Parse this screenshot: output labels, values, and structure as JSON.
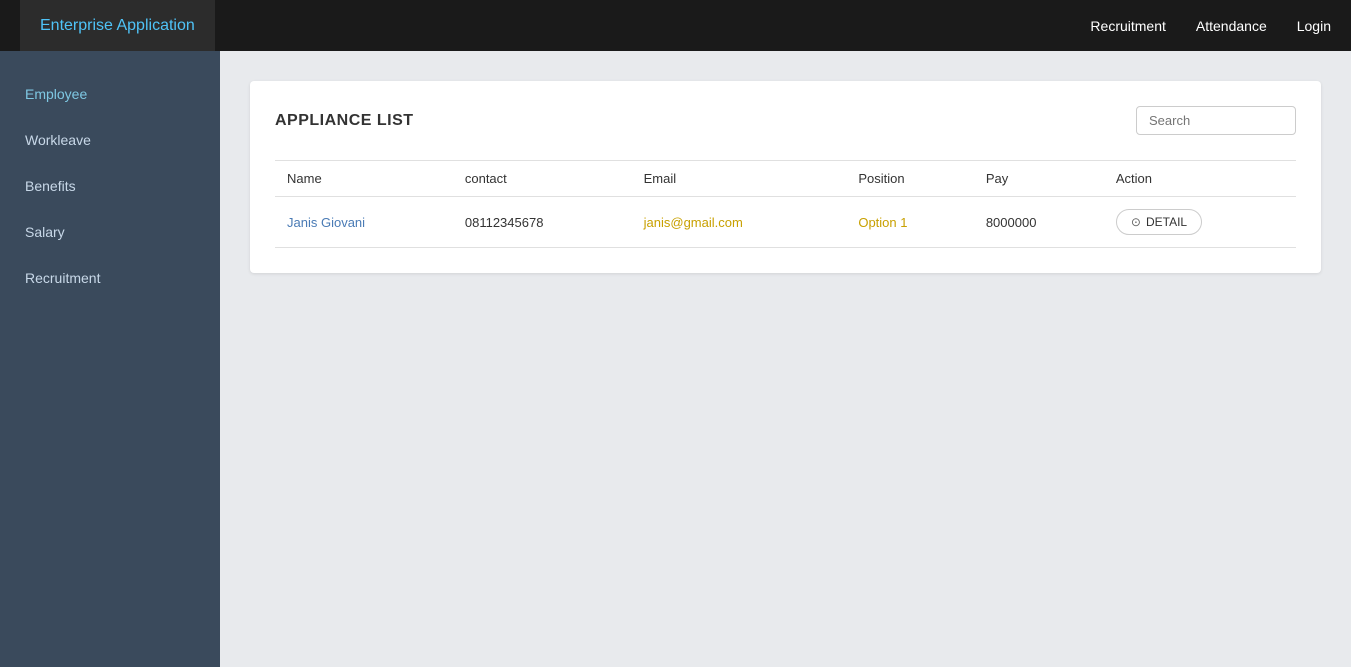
{
  "navbar": {
    "brand": "Enterprise Application",
    "links": [
      {
        "label": "Recruitment",
        "href": "#"
      },
      {
        "label": "Attendance",
        "href": "#"
      },
      {
        "label": "Login",
        "href": "#"
      }
    ]
  },
  "sidebar": {
    "items": [
      {
        "label": "Employee",
        "active": true
      },
      {
        "label": "Workleave",
        "active": false
      },
      {
        "label": "Benefits",
        "active": false
      },
      {
        "label": "Salary",
        "active": false
      },
      {
        "label": "Recruitment",
        "active": false
      }
    ]
  },
  "main": {
    "card": {
      "title": "APPLIANCE LIST",
      "search_placeholder": "Search",
      "table": {
        "columns": [
          "Name",
          "contact",
          "Email",
          "Position",
          "Pay",
          "Action"
        ],
        "rows": [
          {
            "name": "Janis Giovani",
            "contact": "08112345678",
            "email": "janis@gmail.com",
            "position": "Option 1",
            "pay": "8000000",
            "action_label": "DETAIL"
          }
        ]
      }
    }
  },
  "icons": {
    "detail": "⊙"
  }
}
